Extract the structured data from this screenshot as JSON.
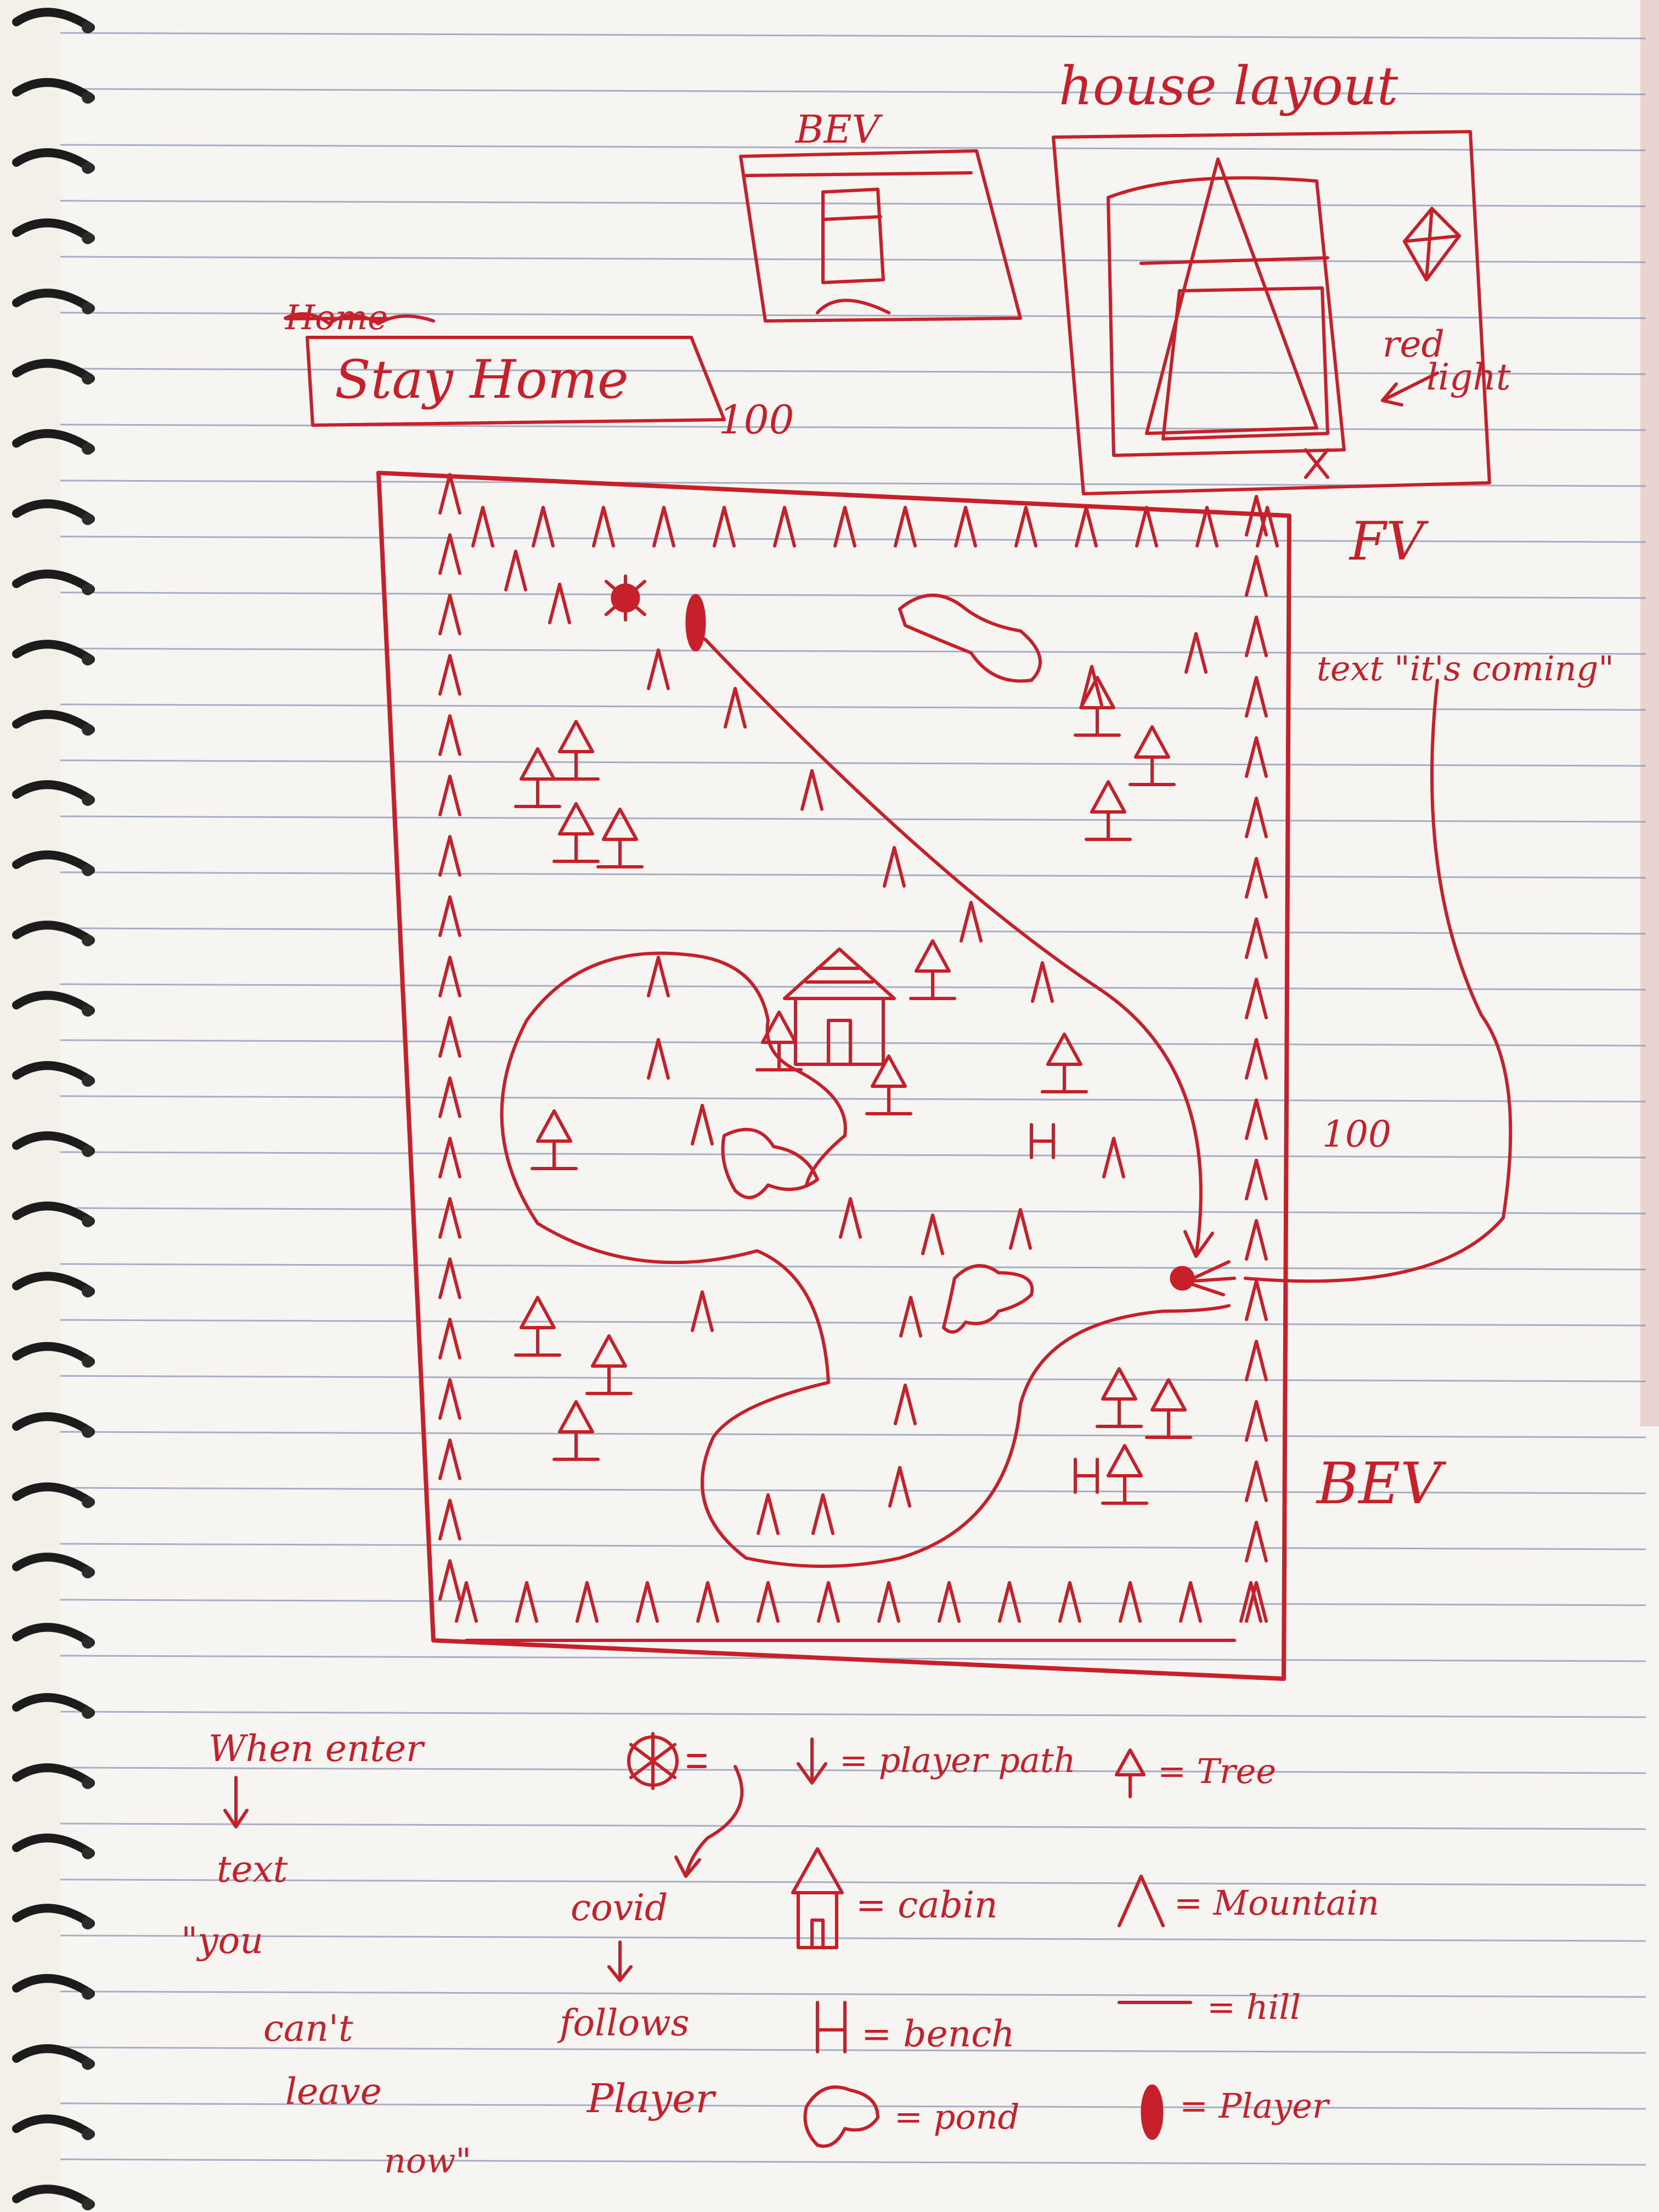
{
  "title": "house layout",
  "bev_box": {
    "label": "BEV"
  },
  "house_layout": {
    "note_top": "red",
    "note_bottom": "light"
  },
  "stay_home_box": {
    "scratched_label": "Home",
    "label": "Stay Home",
    "value": "100"
  },
  "map": {
    "label_top_right": "FV",
    "label_right_middle": "100",
    "label_right_bottom": "BEV",
    "note": "text \"it's coming\""
  },
  "notes_left": {
    "line1": "When enter",
    "line2": "text",
    "line3": "\"you",
    "line4": "can't",
    "line5": "leave",
    "line6": "now\""
  },
  "notes_middle": {
    "line1": "covid",
    "line2": "follows",
    "line3": "Player"
  },
  "legend": {
    "player_path": "= player path",
    "tree": "= Tree",
    "cabin": "= cabin",
    "mountain": "= Mountain",
    "bench": "= bench",
    "hill": "= hill",
    "pond": "= pond",
    "player": "= Player"
  },
  "colors": {
    "ink": "#c8202a",
    "paper": "#f7f5f1",
    "rule": "#8c95b5"
  },
  "icons": [
    "covid-virus-icon",
    "player-path-icon",
    "tree-icon",
    "cabin-icon",
    "mountain-icon",
    "bench-icon",
    "hill-icon",
    "pond-icon",
    "player-icon"
  ]
}
